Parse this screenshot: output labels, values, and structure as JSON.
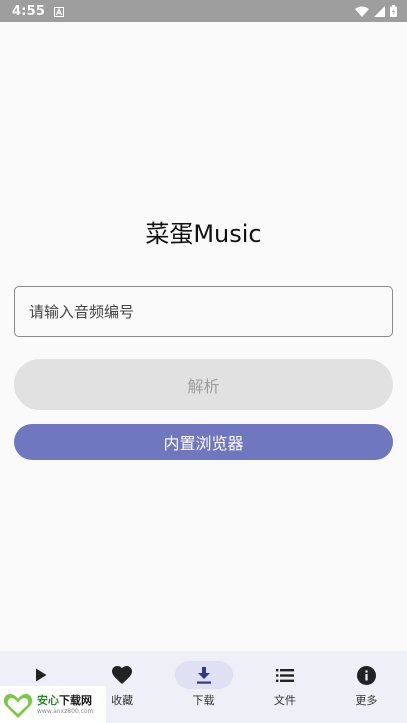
{
  "status_bar": {
    "time": "4:55"
  },
  "app": {
    "title": "菜蛋Music"
  },
  "search": {
    "placeholder": "请输入音频编号",
    "value": ""
  },
  "buttons": {
    "parse_label": "解析",
    "browser_label": "内置浏览器"
  },
  "nav": {
    "active": "download",
    "items": [
      {
        "id": "play",
        "label": "",
        "icon": "play-icon"
      },
      {
        "id": "favorites",
        "label": "收藏",
        "icon": "heart-icon"
      },
      {
        "id": "download",
        "label": "下载",
        "icon": "download-icon"
      },
      {
        "id": "files",
        "label": "文件",
        "icon": "list-icon"
      },
      {
        "id": "more",
        "label": "更多",
        "icon": "info-icon"
      }
    ]
  },
  "watermark": {
    "title_green": "安心",
    "title_dark": "下载网",
    "url": "www.anxz800.com"
  },
  "colors": {
    "accent": "#6f77bf",
    "disabled_button": "#e1e1e1",
    "nav_background": "#efeff7",
    "active_pill": "#dfe0f3"
  }
}
